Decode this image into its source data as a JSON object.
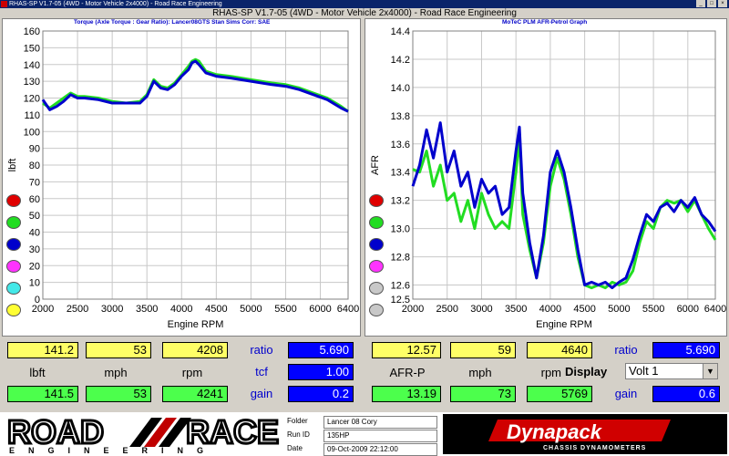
{
  "window": {
    "titlebar_text": "RHAS-SP V1.7-05  (4WD - Motor Vehicle 2x4000) - Road Race Engineering",
    "app_title": "RHAS-SP V1.7-05   (4WD - Motor Vehicle 2x4000) - Road Race Engineering",
    "controls": [
      "_",
      "□",
      "×"
    ]
  },
  "left_panel": {
    "subtitle": "Torque (Axle Torque : Gear Ratio): Lancer08GTS Stan Sims       Corr: SAE",
    "dots": [
      "#e00000",
      "#22dd22",
      "#0000cc",
      "#ff33ff",
      "#44e8e8",
      "#ffff33"
    ]
  },
  "right_panel": {
    "subtitle": "MoTeC PLM AFR-Petrol Graph",
    "dots": [
      "#e00000",
      "#22dd22",
      "#0000cc",
      "#ff33ff",
      "#c8c8c8",
      "#c8c8c8"
    ]
  },
  "chart_data": [
    {
      "type": "line",
      "title": "",
      "xlabel": "Engine RPM",
      "ylabel": "lbft",
      "xlim": [
        2000,
        6400
      ],
      "ylim": [
        0,
        160
      ],
      "xticks": [
        2000,
        2500,
        3000,
        3500,
        4000,
        4500,
        5000,
        5500,
        6000,
        6400
      ],
      "yticks": [
        0,
        10,
        20,
        30,
        40,
        50,
        60,
        70,
        80,
        90,
        100,
        110,
        120,
        130,
        140,
        150,
        160
      ],
      "grid": true,
      "series": [
        {
          "color": "#22dd22",
          "x": [
            2000,
            2100,
            2200,
            2300,
            2400,
            2500,
            2600,
            2800,
            3000,
            3200,
            3400,
            3500,
            3600,
            3700,
            3800,
            3900,
            4000,
            4100,
            4150,
            4200,
            4250,
            4350,
            4500,
            4700,
            5000,
            5300,
            5500,
            5700,
            5900,
            6100,
            6300,
            6400
          ],
          "y": [
            117,
            114,
            117,
            120,
            123,
            121,
            121,
            120,
            118,
            117,
            118,
            122,
            131,
            127,
            126,
            129,
            134,
            139,
            142,
            143,
            142,
            136,
            134,
            133,
            131,
            129,
            128,
            126,
            123,
            120,
            115,
            112
          ]
        },
        {
          "color": "#0000cc",
          "x": [
            2000,
            2100,
            2200,
            2300,
            2400,
            2500,
            2600,
            2800,
            3000,
            3200,
            3400,
            3500,
            3600,
            3700,
            3800,
            3900,
            4000,
            4100,
            4150,
            4200,
            4250,
            4350,
            4500,
            4700,
            5000,
            5300,
            5500,
            5700,
            5900,
            6100,
            6300,
            6400
          ],
          "y": [
            119,
            113,
            115,
            118,
            122,
            120,
            120,
            119,
            117,
            117,
            117,
            121,
            130,
            126,
            125,
            128,
            133,
            137,
            141,
            142,
            140,
            135,
            133,
            132,
            130,
            128,
            127,
            125,
            122,
            119,
            114,
            112
          ]
        }
      ]
    },
    {
      "type": "line",
      "title": "",
      "xlabel": "Engine RPM",
      "ylabel": "AFR",
      "xlim": [
        2000,
        6400
      ],
      "ylim": [
        12.5,
        14.4
      ],
      "xticks": [
        2000,
        2500,
        3000,
        3500,
        4000,
        4500,
        5000,
        5500,
        6000,
        6400
      ],
      "yticks": [
        12.5,
        12.6,
        12.8,
        13.0,
        13.2,
        13.4,
        13.6,
        13.8,
        14.0,
        14.2,
        14.4
      ],
      "grid": true,
      "series": [
        {
          "color": "#22dd22",
          "x": [
            2000,
            2100,
            2200,
            2300,
            2400,
            2500,
            2600,
            2700,
            2800,
            2900,
            3000,
            3100,
            3200,
            3300,
            3400,
            3500,
            3550,
            3600,
            3700,
            3800,
            3900,
            4000,
            4100,
            4200,
            4300,
            4400,
            4500,
            4600,
            4700,
            4800,
            4900,
            5000,
            5100,
            5200,
            5300,
            5400,
            5500,
            5600,
            5700,
            5800,
            5900,
            6000,
            6100,
            6200,
            6300,
            6400
          ],
          "y": [
            13.42,
            13.4,
            13.55,
            13.3,
            13.45,
            13.2,
            13.25,
            13.05,
            13.2,
            13.0,
            13.25,
            13.1,
            13.0,
            13.05,
            13.0,
            13.4,
            13.65,
            13.1,
            12.85,
            12.65,
            12.9,
            13.3,
            13.5,
            13.35,
            13.1,
            12.8,
            12.6,
            12.58,
            12.6,
            12.58,
            12.62,
            12.6,
            12.62,
            12.7,
            12.9,
            13.05,
            13.0,
            13.15,
            13.2,
            13.18,
            13.2,
            13.12,
            13.2,
            13.1,
            13.0,
            12.92
          ]
        },
        {
          "color": "#0000cc",
          "x": [
            2000,
            2100,
            2200,
            2300,
            2400,
            2500,
            2600,
            2700,
            2800,
            2900,
            3000,
            3100,
            3200,
            3300,
            3400,
            3500,
            3550,
            3600,
            3700,
            3800,
            3900,
            4000,
            4100,
            4200,
            4300,
            4400,
            4500,
            4600,
            4700,
            4800,
            4900,
            5000,
            5100,
            5200,
            5300,
            5400,
            5500,
            5600,
            5700,
            5800,
            5900,
            6000,
            6100,
            6200,
            6300,
            6400
          ],
          "y": [
            13.3,
            13.45,
            13.7,
            13.5,
            13.75,
            13.4,
            13.55,
            13.3,
            13.4,
            13.15,
            13.35,
            13.25,
            13.3,
            13.1,
            13.15,
            13.55,
            13.72,
            13.25,
            12.9,
            12.65,
            12.95,
            13.4,
            13.55,
            13.4,
            13.15,
            12.85,
            12.6,
            12.62,
            12.6,
            12.62,
            12.58,
            12.62,
            12.65,
            12.78,
            12.95,
            13.1,
            13.05,
            13.15,
            13.18,
            13.12,
            13.2,
            13.15,
            13.22,
            13.1,
            13.05,
            12.98
          ]
        }
      ]
    }
  ],
  "readouts_left": {
    "row1": [
      "141.2",
      "53",
      "4208"
    ],
    "row2_labels": [
      "lbft",
      "mph",
      "rpm"
    ],
    "row3": [
      "141.5",
      "53",
      "4241"
    ],
    "side_labels": [
      "ratio",
      "tcf",
      "gain"
    ],
    "side_values": [
      "5.690",
      "1.00",
      "0.2"
    ]
  },
  "readouts_right": {
    "row1": [
      "12.57",
      "59",
      "4640"
    ],
    "row2_labels": [
      "AFR-P",
      "mph",
      "rpm"
    ],
    "display_label": "Display",
    "display_value": "Volt 1",
    "row3": [
      "13.19",
      "73",
      "5769"
    ],
    "side_labels": [
      "ratio",
      "gain"
    ],
    "side_values": [
      "5.690",
      "0.6"
    ]
  },
  "footer": {
    "logo_line1": "ROAD",
    "logo_line1b": "RACE",
    "logo_line2": "ENGINEERING",
    "folder_label": "Folder",
    "folder_value": "Lancer 08 Cory",
    "runid_label": "Run ID",
    "runid_value": "135HP",
    "date_label": "Date",
    "date_value": "09-Oct-2009  22:12:00",
    "dyno_brand": "Dynapack",
    "dyno_sub": "CHASSIS DYNAMOMETERS"
  }
}
